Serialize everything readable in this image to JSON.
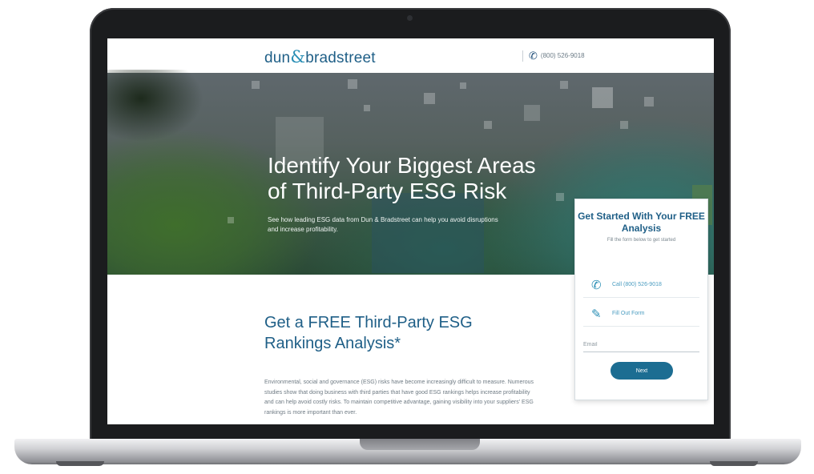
{
  "header": {
    "logo_left": "dun",
    "logo_amp": "&",
    "logo_right": "bradstreet",
    "phone": "(800) 526-9018"
  },
  "hero": {
    "title": "Identify Your Biggest Areas of Third-Party ESG Risk",
    "subtitle": "See how leading ESG data from Dun & Bradstreet can help you avoid disruptions and increase profitability."
  },
  "content": {
    "title": "Get a FREE Third-Party ESG Rankings Analysis*",
    "body": "Environmental, social and governance (ESG) risks have become increasingly difficult to measure. Numerous studies show that doing business with third parties that have good ESG rankings helps increase profitability and can help avoid costly risks. To maintain competitive advantage, gaining visibility into your suppliers' ESG rankings is more important than ever."
  },
  "form": {
    "title": "Get Started With Your FREE Analysis",
    "subtitle": "Fill the form below to get started",
    "call_label": "Call (800) 526-9018",
    "form_label": "Fill Out Form",
    "email_placeholder": "Email",
    "next_label": "Next"
  },
  "colors": {
    "brand": "#1f5f87",
    "accent": "#2b8fb5",
    "button": "#1c6d92"
  },
  "icons": {
    "phone": "phone-icon",
    "edit": "edit-form-icon"
  }
}
